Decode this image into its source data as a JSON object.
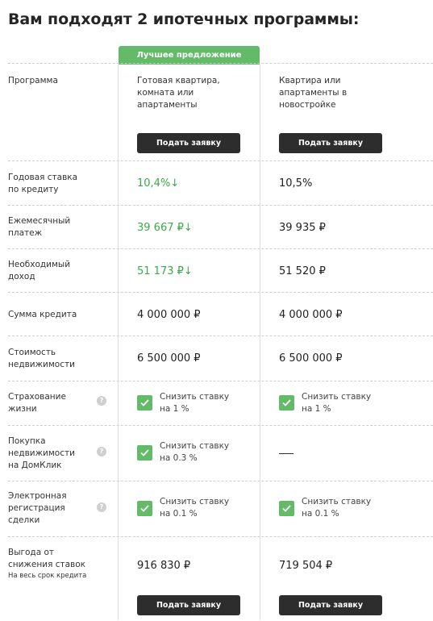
{
  "title": "Вам подходят 2 ипотечных программы:",
  "best_offer_label": "Лучшее предложение",
  "apply_label": "Подать заявку",
  "discount_text": "Снизить ставку",
  "rows": {
    "program": {
      "label": "Программа",
      "col1": "Готовая квартира, комната или апартаменты",
      "col2": "Квартира или апартаменты в новостройке"
    },
    "rate": {
      "label": "Годовая ставка по кредиту",
      "col1": "10,4%↓",
      "col2": "10,5%"
    },
    "payment": {
      "label": "Ежемесячный платеж",
      "col1": "39 667 ₽↓",
      "col2": "39 935 ₽"
    },
    "income": {
      "label": "Необходимый доход",
      "col1": "51 173 ₽↓",
      "col2": "51 520 ₽"
    },
    "loan": {
      "label": "Сумма кредита",
      "col1": "4 000 000 ₽",
      "col2": "4 000 000 ₽"
    },
    "property": {
      "label": "Стоимость недвижимости",
      "col1": "6 500 000 ₽",
      "col2": "6 500 000 ₽"
    },
    "insurance": {
      "label": "Страхование жизни",
      "col1": "на 1 %",
      "col2": "на 1 %"
    },
    "domclick": {
      "label": "Покупка недвижимости на ДомКлик",
      "col1": "на 0.3 %",
      "col2": "—"
    },
    "registration": {
      "label": "Электронная регистрация сделки",
      "col1": "на 0.1 %",
      "col2": "на 0.1 %"
    },
    "savings": {
      "label": "Выгода от снижения ставок",
      "sublabel": "На весь срок кредита",
      "col1": "916 830 ₽",
      "col2": "719 504 ₽"
    }
  },
  "colors": {
    "accent_green": "#63bb6a",
    "value_green": "#3aaa49",
    "button_dark": "#2d2d2d"
  },
  "icons": {
    "help": "question-circle-icon",
    "check": "checkbox-checked-icon"
  }
}
